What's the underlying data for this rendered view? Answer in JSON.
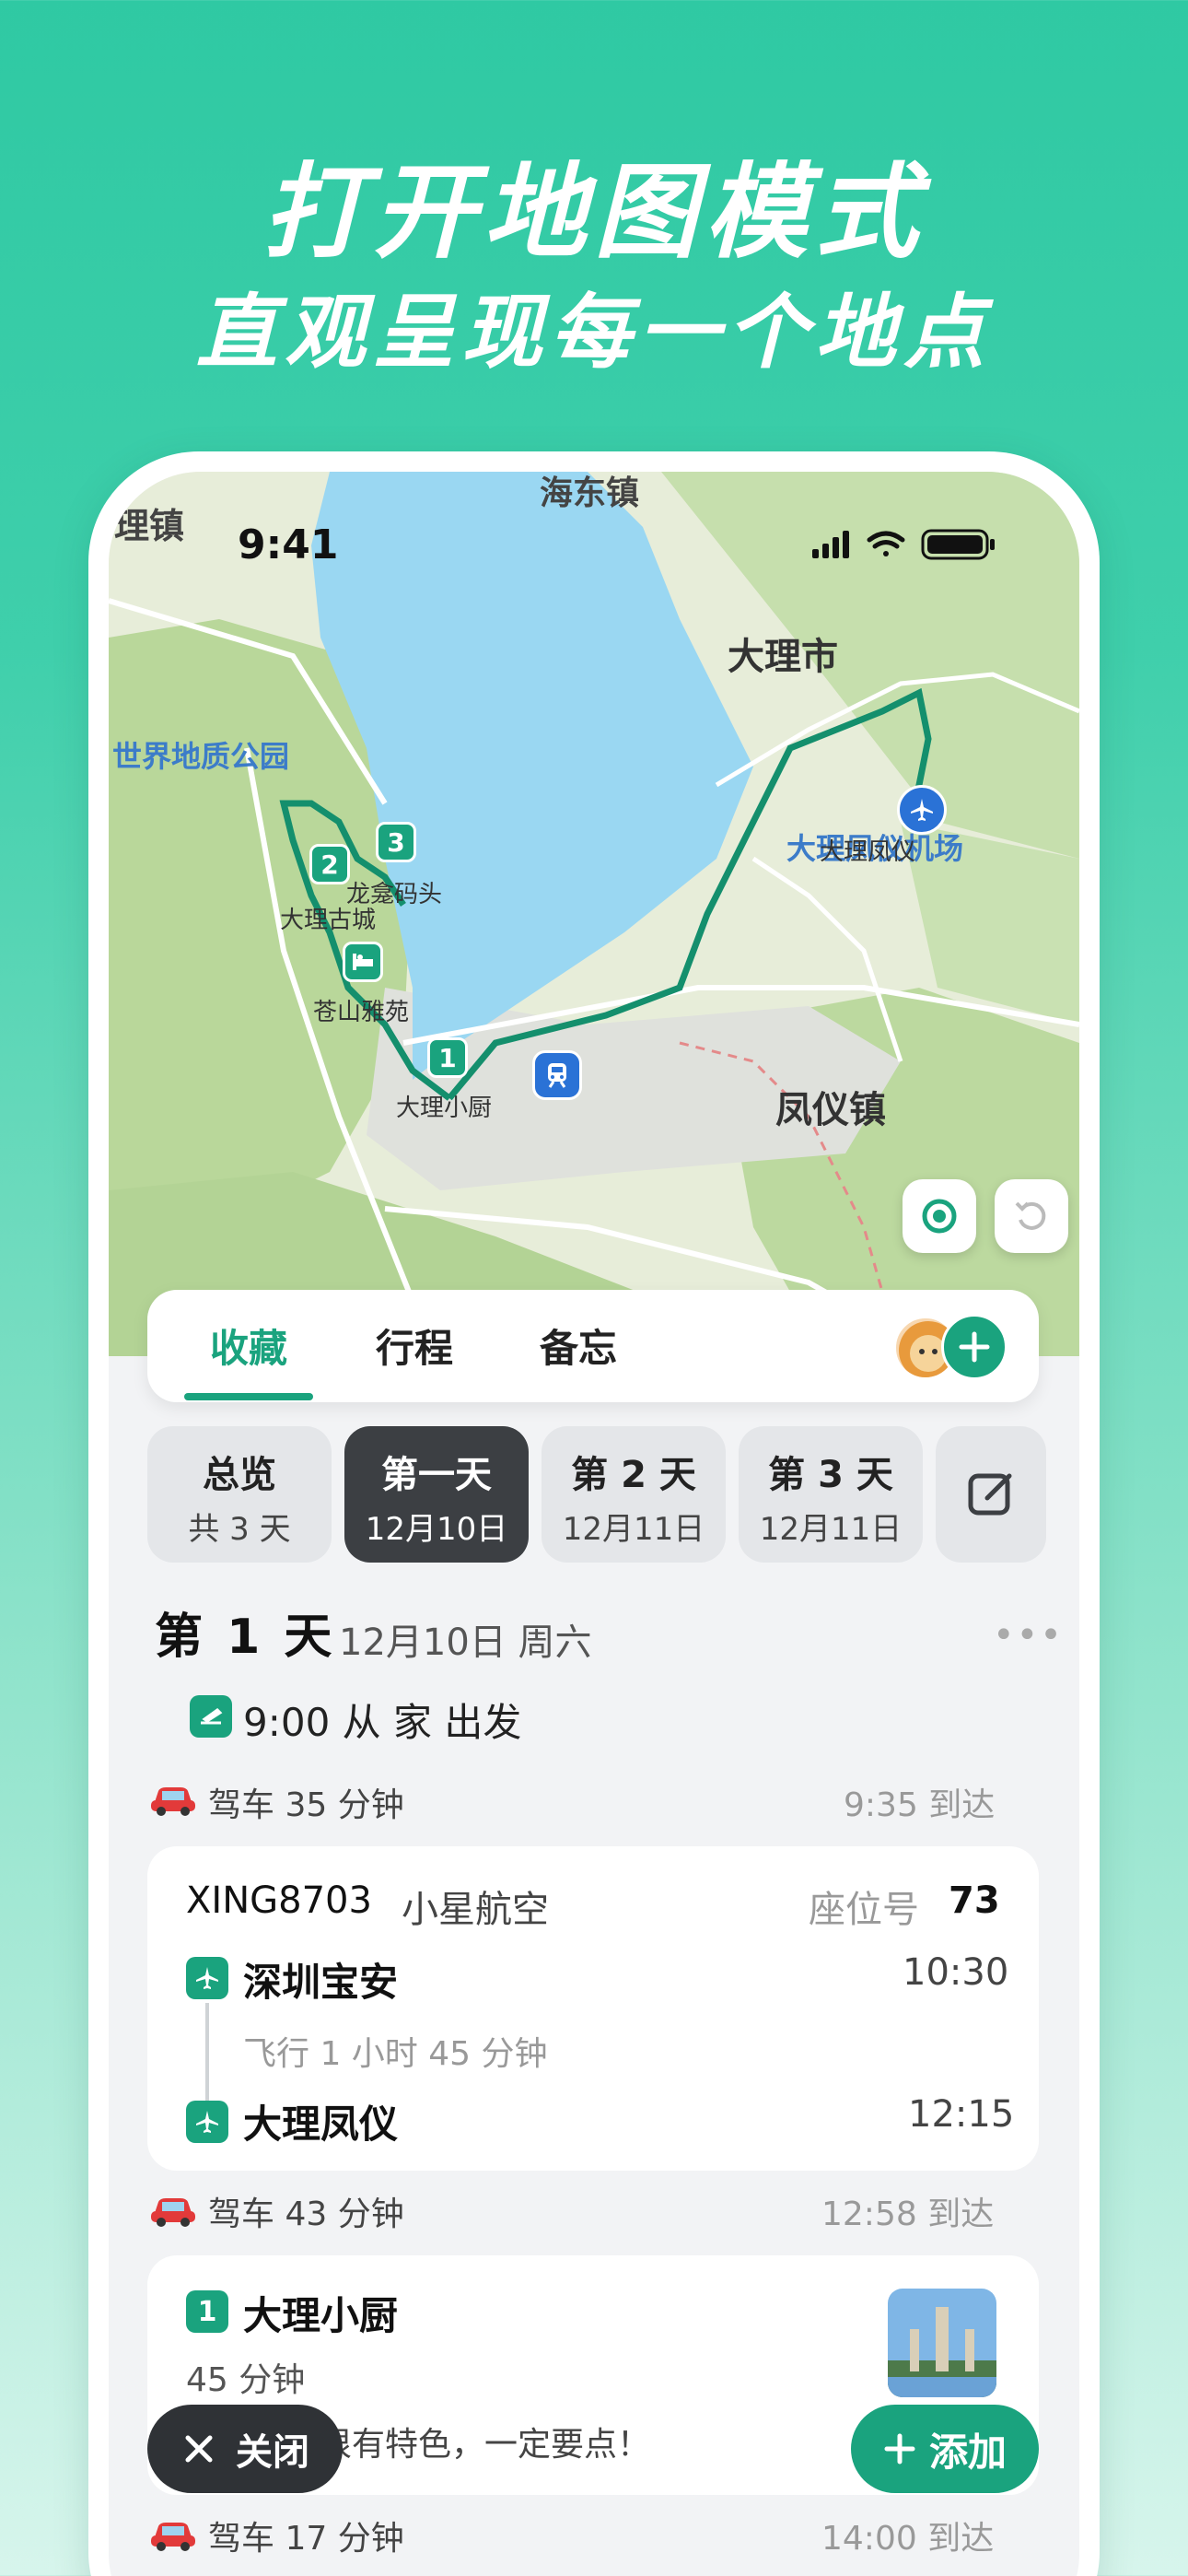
{
  "headline": {
    "line1": "打开地图模式",
    "line2": "直观呈现每一个地点"
  },
  "status_bar": {
    "time": "9:41"
  },
  "map": {
    "labels": {
      "haidong": "海东镇",
      "lizhen": "理镇",
      "dali_city": "大理市",
      "geopark": "世界地质公园",
      "airport": "大理凤仪机场",
      "airport_sub": "大理凤仪",
      "longkan": "龙龛码头",
      "ancient_city": "大理古城",
      "cangshan": "苍山雅苑",
      "xiaochu": "大理小厨",
      "fengyi": "凤仪镇"
    },
    "markers": [
      "1",
      "2",
      "3"
    ]
  },
  "tabs": {
    "favorites": "收藏",
    "itinerary": "行程",
    "memo": "备忘"
  },
  "days": [
    {
      "title": "总览",
      "sub": "共 3 天"
    },
    {
      "title": "第一天",
      "sub": "12月10日"
    },
    {
      "title": "第 2 天",
      "sub": "12月11日"
    },
    {
      "title": "第 3 天",
      "sub": "12月11日"
    }
  ],
  "day_header": {
    "title": "第 1 天",
    "date": "12月10日 周六",
    "more": "•••"
  },
  "departure": {
    "text": "9:00 从 家 出发"
  },
  "drive1": {
    "label": "驾车 35 分钟",
    "arrive": "9:35 到达"
  },
  "flight": {
    "number": "XING8703",
    "airline": "小星航空",
    "seat_label": "座位号",
    "seat": "73",
    "from": "深圳宝安",
    "dep_time": "10:30",
    "duration": "飞行 1 小时 45 分钟",
    "to": "大理凤仪",
    "arr_time": "12:15"
  },
  "drive2": {
    "label": "驾车 43 分钟",
    "arrive": "12:58 到达"
  },
  "place": {
    "index": "1",
    "name": "大理小厨",
    "stay": "45 分钟",
    "note": "大理小厨很有特色，一定要点！"
  },
  "drive3": {
    "label": "驾车 17 分钟",
    "arrive": "14:00 到达"
  },
  "buttons": {
    "close": "关闭",
    "add": "添加"
  },
  "colors": {
    "accent": "#1aa37e",
    "brand_bg": "#2fc9a3",
    "dark": "#2f3236"
  }
}
